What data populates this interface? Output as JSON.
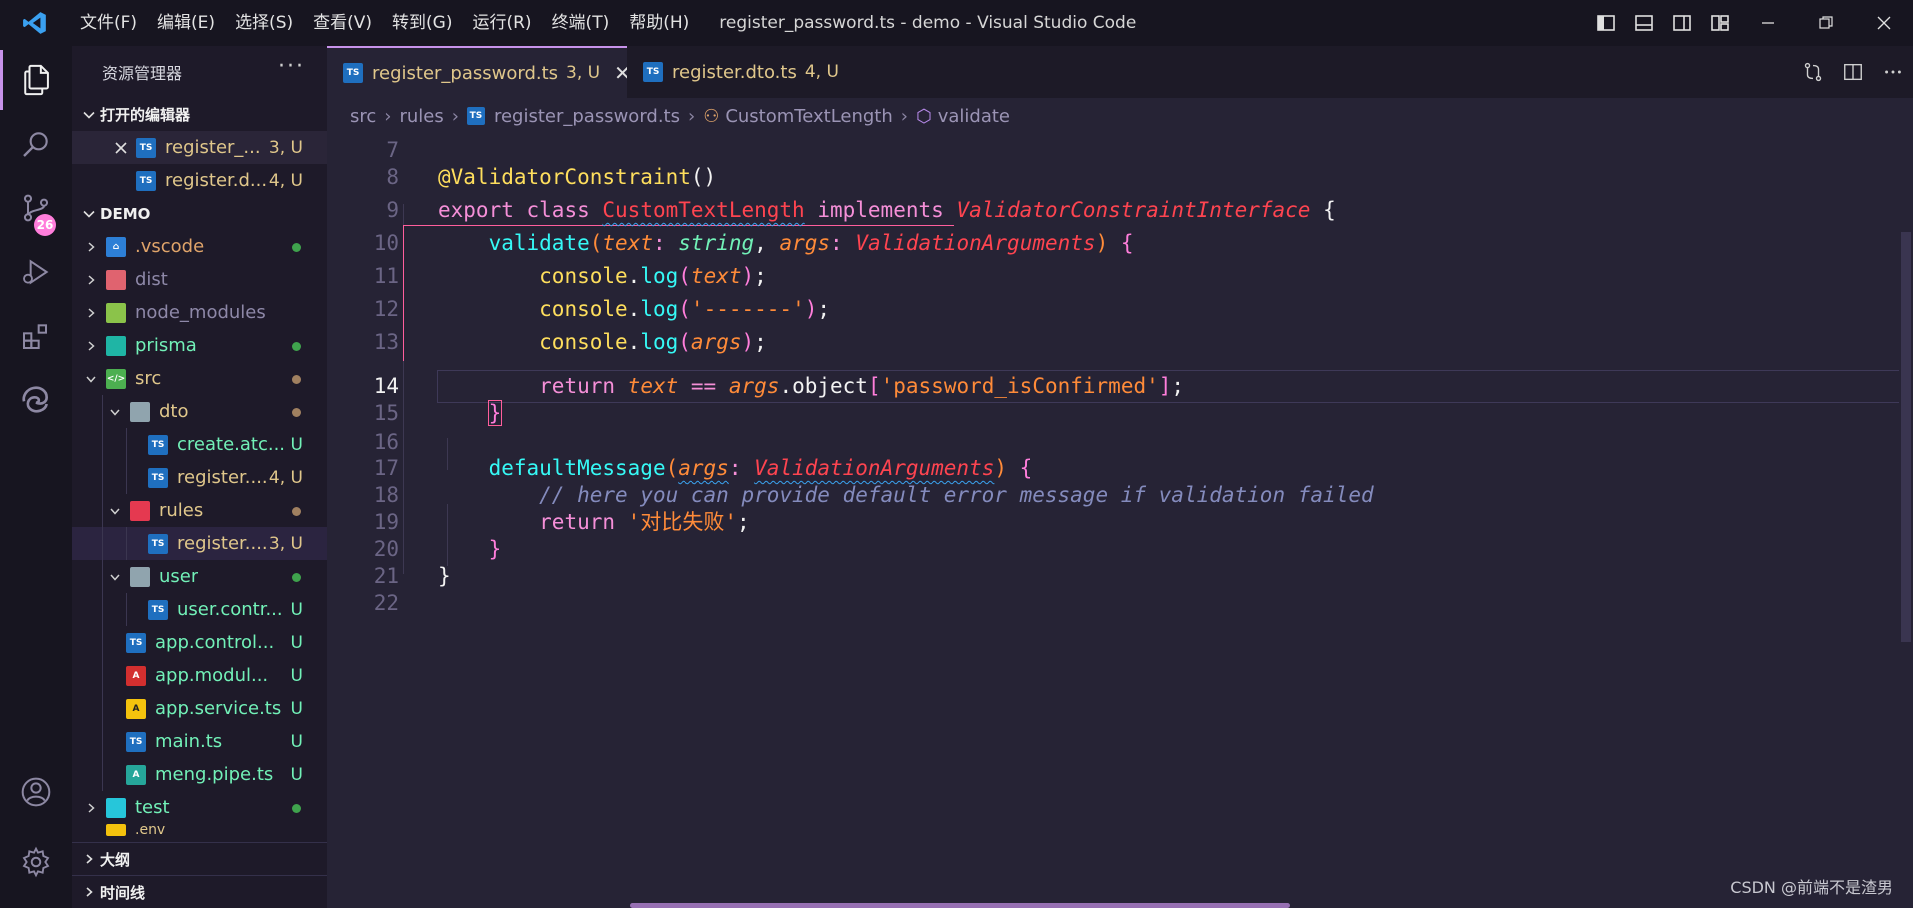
{
  "titlebar": {
    "menu": [
      "文件(F)",
      "编辑(E)",
      "选择(S)",
      "查看(V)",
      "转到(G)",
      "运行(R)",
      "终端(T)",
      "帮助(H)"
    ],
    "title": "register_password.ts - demo - Visual Studio Code"
  },
  "activitybar": {
    "scm_badge": "26"
  },
  "sidebar": {
    "title": "资源管理器",
    "more": "···",
    "open_editors_label": "打开的编辑器",
    "open_editors": [
      {
        "name": "register_...",
        "status": "3, U"
      },
      {
        "name": "register.d...",
        "status": "4, U"
      }
    ],
    "workspace_label": "DEMO",
    "tree": [
      {
        "name": ".vscode",
        "status": ""
      },
      {
        "name": "dist",
        "status": ""
      },
      {
        "name": "node_modules",
        "status": ""
      },
      {
        "name": "prisma",
        "status": ""
      },
      {
        "name": "src",
        "status": ""
      },
      {
        "name": "dto",
        "status": ""
      },
      {
        "name": "create.atc...",
        "status": "U"
      },
      {
        "name": "register....",
        "status": "4, U"
      },
      {
        "name": "rules",
        "status": ""
      },
      {
        "name": "register....",
        "status": "3, U"
      },
      {
        "name": "user",
        "status": ""
      },
      {
        "name": "user.contr...",
        "status": "U"
      },
      {
        "name": "app.control...",
        "status": "U"
      },
      {
        "name": "app.modul...",
        "status": "U"
      },
      {
        "name": "app.service.ts",
        "status": "U"
      },
      {
        "name": "main.ts",
        "status": "U"
      },
      {
        "name": "meng.pipe.ts",
        "status": "U"
      },
      {
        "name": "test",
        "status": ""
      },
      {
        "name": ".env",
        "status": "U"
      }
    ],
    "outline_label": "大纲",
    "timeline_label": "时间线"
  },
  "tabs": [
    {
      "label": "register_password.ts",
      "status": "3, U"
    },
    {
      "label": "register.dto.ts",
      "status": "4, U"
    }
  ],
  "breadcrumb": {
    "seg1": "src",
    "seg2": "rules",
    "seg3": "register_password.ts",
    "seg4": "CustomTextLength",
    "seg5": "validate"
  },
  "editor": {
    "line_numbers": [
      "7",
      "8",
      "9",
      "10",
      "11",
      "12",
      "13",
      "14",
      "15",
      "16",
      "17",
      "18",
      "19",
      "20",
      "21",
      "22"
    ],
    "code": {
      "l8_decorator": "@ValidatorConstraint",
      "l8_paren": "()",
      "l9_export": "export",
      "l9_class": "class",
      "l9_name": "CustomTextLength",
      "l9_implements": "implements",
      "l9_iface": "ValidatorConstraintInterface",
      "l9_brace": "{",
      "l10_fn": "validate",
      "l10_p1": "text",
      "l10_t1": "string",
      "l10_p2": "args",
      "l10_t2": "ValidationArguments",
      "console": "console",
      "log": "log",
      "l11_arg": "text",
      "l12_arg": "'-------'",
      "l13_arg": "args",
      "return": "return",
      "l14_text": "text",
      "l14_op": "==",
      "l14_args": "args",
      "l14_obj": "object",
      "l14_key": "'password_isConfirmed'",
      "l17_fn": "defaultMessage",
      "l17_p": "args",
      "l17_t": "ValidationArguments",
      "l18_comment": "// here you can provide default error message if validation failed",
      "l19_str": "'对比失败'",
      "close_brace": "}"
    }
  },
  "watermark": "CSDN @前端不是渣男"
}
